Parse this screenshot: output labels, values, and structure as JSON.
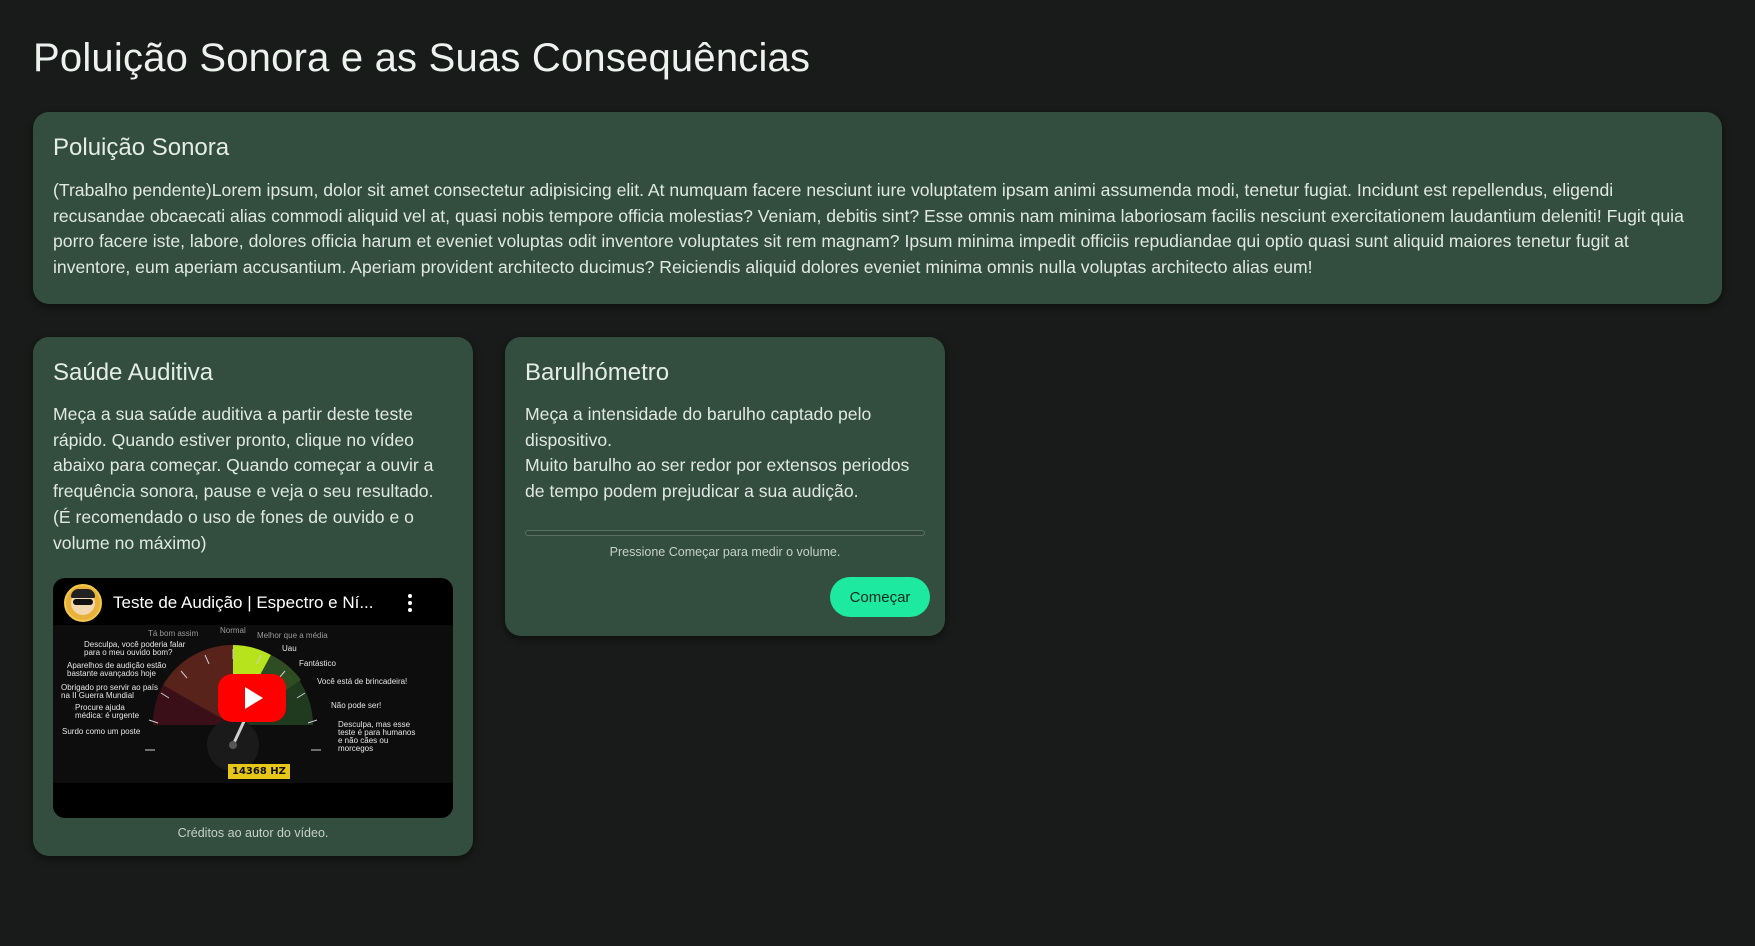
{
  "page": {
    "title": "Poluição Sonora e as Suas Consequências"
  },
  "intro": {
    "heading": "Poluição Sonora",
    "text": "(Trabalho pendente)Lorem ipsum, dolor sit amet consectetur adipisicing elit. At numquam facere nesciunt iure voluptatem ipsam animi assumenda modi, tenetur fugiat. Incidunt est repellendus, eligendi recusandae obcaecati alias commodi aliquid vel at, quasi nobis tempore officia molestias? Veniam, debitis sint? Esse omnis nam minima laboriosam facilis nesciunt exercitationem laudantium deleniti! Fugit quia porro facere iste, labore, dolores officia harum et eveniet voluptas odit inventore voluptates sit rem magnam? Ipsum minima impedit officiis repudiandae qui optio quasi sunt aliquid maiores tenetur fugit at inventore, eum aperiam accusantium. Aperiam provident architecto ducimus? Reiciendis aliquid dolores eveniet minima omnis nulla voluptas architecto alias eum!"
  },
  "health": {
    "heading": "Saúde Auditiva",
    "text": "Meça a sua saúde auditiva a partir deste teste rápido. Quando estiver pronto, clique no vídeo abaixo para começar. Quando começar a ouvir a frequência sonora, pause e veja o seu resultado. (É recomendado o uso de fones de ouvido e o volume no máximo)",
    "video": {
      "title": "Teste de Audição | Espectro e Ní...",
      "icon": "play-icon",
      "hz": "14368 HZ",
      "labels_left": [
        "Desculpa, você poderia falar para o meu ouvido bom?",
        "Aparelhos de audição estão bastante avançados hoje",
        "Obrigado pro servir ao país na II Guerra Mundial",
        "Procure ajuda médica: é urgente",
        "Surdo como um poste"
      ],
      "labels_top": [
        "Tá bom assim",
        "Normal",
        "Melhor que a média"
      ],
      "labels_right": [
        "Uau",
        "Fantástico",
        "Você está de brincadeira!",
        "Não pode ser!",
        "Desculpa, mas esse teste é para humanos e não cães ou morcegos"
      ]
    },
    "credits": "Créditos ao autor do vídeo."
  },
  "meter": {
    "heading": "Barulhómetro",
    "text_line1": "Meça a intensidade do barulho captado pelo dispositivo.",
    "text_line2": "Muito barulho ao ser redor por extensos periodos de tempo podem prejudicar a sua audição.",
    "level": 0,
    "status": "Pressione Começar para medir o volume.",
    "button_label": "Começar"
  },
  "colors": {
    "background": "#181b19",
    "card": "#334e3f",
    "accent": "#1de9a0"
  }
}
